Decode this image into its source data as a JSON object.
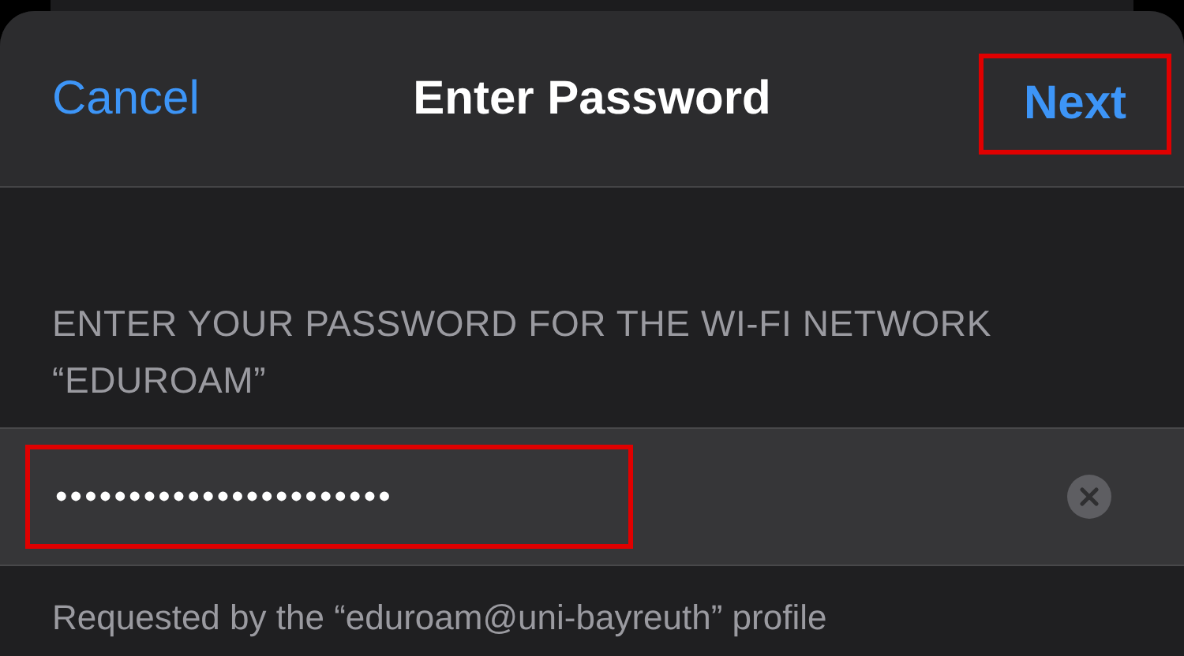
{
  "nav_bar": {
    "cancel": "Cancel",
    "title": "Enter Password",
    "next": "Next",
    "next_highlighted": true
  },
  "section_header": "ENTER YOUR PASSWORD FOR THE WI-FI NETWORK “EDUROAM”",
  "password_field": {
    "value": "•••••••••••••••••••••••",
    "highlighted": true,
    "clear_button": true
  },
  "footer": "Requested by the “eduroam@uni-bayreuth” profile"
}
